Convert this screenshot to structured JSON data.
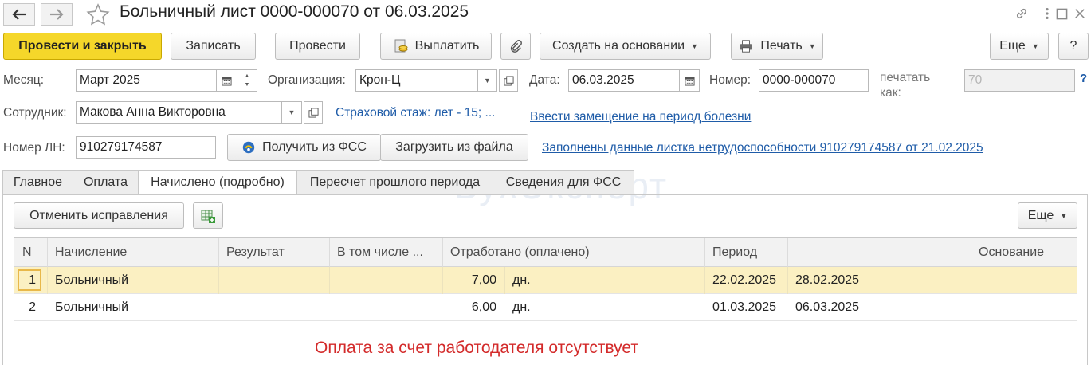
{
  "window": {
    "title": "Больничный лист 0000-000070 от 06.03.2025"
  },
  "toolbar": {
    "post_close": "Провести и закрыть",
    "save": "Записать",
    "post": "Провести",
    "pay": "Выплатить",
    "create_based": "Создать на основании",
    "print": "Печать",
    "more": "Еще",
    "help": "?"
  },
  "form": {
    "month_label": "Месяц:",
    "month_value": "Март 2025",
    "org_label": "Организация:",
    "org_value": "Крон-Ц",
    "date_label": "Дата:",
    "date_value": "06.03.2025",
    "number_label": "Номер:",
    "number_value": "0000-000070",
    "print_as_label_1": "печатать",
    "print_as_label_2": "как:",
    "print_as_value": "70",
    "help_mark": "?",
    "employee_label": "Сотрудник:",
    "employee_value": "Макова Анна Викторовна",
    "insurance_link": "Страховой стаж: лет - 15; ...",
    "replacement_link": "Ввести замещение на период болезни",
    "ln_label": "Номер ЛН:",
    "ln_value": "910279174587",
    "get_fss": "Получить из ФСС",
    "load_file": "Загрузить из файла",
    "filled_link": "Заполнены данные листка нетрудоспособности 910279174587 от 21.02.2025"
  },
  "tabs": [
    {
      "label": "Главное"
    },
    {
      "label": "Оплата"
    },
    {
      "label": "Начислено (подробно)"
    },
    {
      "label": "Пересчет прошлого периода"
    },
    {
      "label": "Сведения для ФСС"
    }
  ],
  "panel": {
    "cancel_corrections": "Отменить исправления",
    "more": "Еще"
  },
  "table": {
    "columns": {
      "n": "N",
      "accrual": "Начисление",
      "result": "Результат",
      "including": "В том числе ...",
      "worked": "Отработано (оплачено)",
      "period": "Период",
      "basis": "Основание"
    },
    "rows": [
      {
        "n": "1",
        "accrual": "Больничный",
        "result": "",
        "including": "",
        "worked": "7,00",
        "unit": "дн.",
        "period_from": "22.02.2025",
        "period_to": "28.02.2025",
        "basis": ""
      },
      {
        "n": "2",
        "accrual": "Больничный",
        "result": "",
        "including": "",
        "worked": "6,00",
        "unit": "дн.",
        "period_from": "01.03.2025",
        "period_to": "06.03.2025",
        "basis": ""
      }
    ]
  },
  "notice": "Оплата за счет работодателя отсутствует",
  "watermark": "БухЭксперт",
  "colors": {
    "primary_button": "#f5d72a",
    "selected_row": "#fbf0c2",
    "link": "#1f5ca8",
    "notice": "#d32a2a"
  }
}
